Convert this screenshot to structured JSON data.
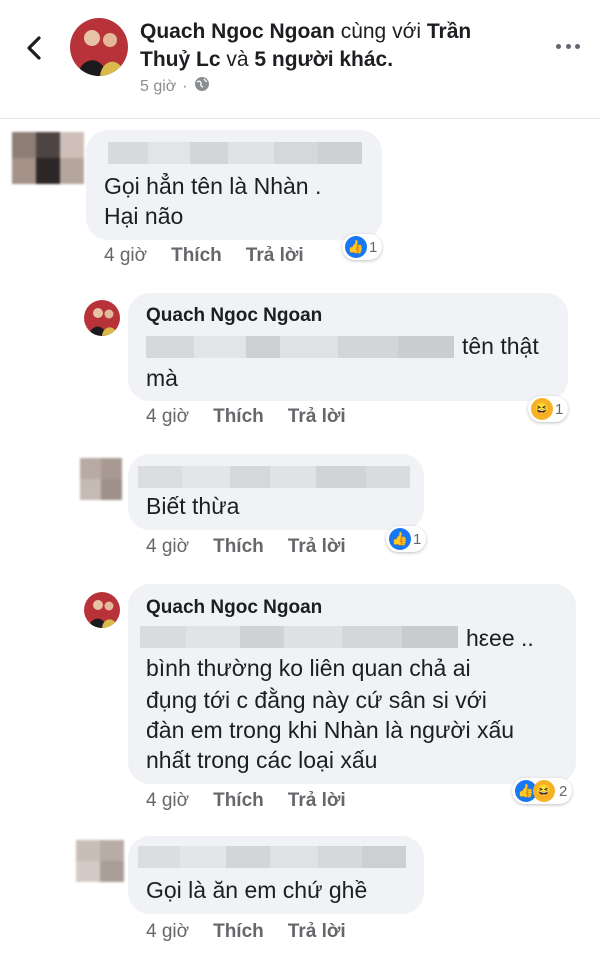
{
  "header": {
    "author": "Quach Ngoc Ngoan",
    "with_word": "cùng với",
    "tagged": "Trần Thuỷ Lc",
    "and_word": "và",
    "others": "5 người khác.",
    "time": "5 giờ",
    "privacy_icon": "globe-icon"
  },
  "actions": {
    "like": "Thích",
    "reply": "Trả lời"
  },
  "comments": [
    {
      "time": "4 giờ",
      "text1": "Gọi hẳn tên là Nhàn .",
      "text2": "Hại não",
      "reaction_count": "1"
    },
    {
      "author": "Quach Ngoc Ngoan",
      "time": "4 giờ",
      "text1": "tên thật",
      "text2": "mà",
      "reaction_count": "1"
    },
    {
      "time": "4 giờ",
      "text1": "Biết thừa",
      "reaction_count": "1"
    },
    {
      "author": "Quach Ngoc Ngoan",
      "time": "4 giờ",
      "text1": "hεee ..",
      "text2": "bình thường ko liên quan chả ai",
      "text3": "đụng tới c đằng này cứ sân si với",
      "text4": "đàn em trong khi Nhàn là người xấu",
      "text5": "nhất trong các loại xấu",
      "reaction_count": "2"
    },
    {
      "time": "4 giờ",
      "text1": "Gọi là ăn em chứ ghề"
    }
  ],
  "colors": {
    "like_blue": "#1877f2",
    "haha_yellow": "#f7b125",
    "bubble": "#f0f2f5"
  }
}
